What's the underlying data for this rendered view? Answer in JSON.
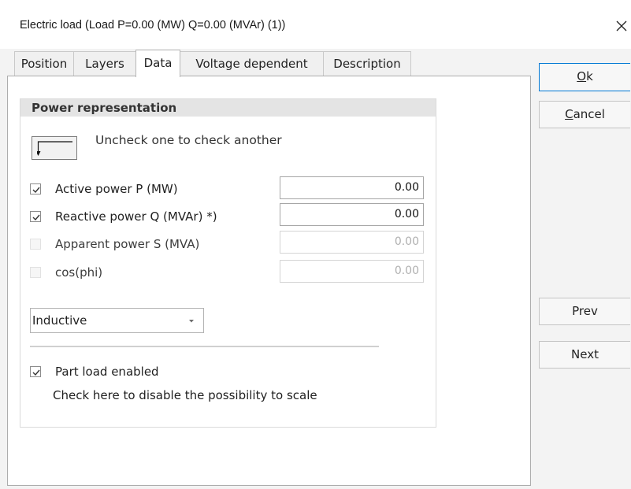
{
  "window": {
    "title": "Electric load   (Load P=0.00 (MW) Q=0.00 (MVAr) (1))"
  },
  "tabs": [
    {
      "label": "Position",
      "active": false
    },
    {
      "label": "Layers",
      "active": false
    },
    {
      "label": "Data",
      "active": true
    },
    {
      "label": "Voltage dependent",
      "active": false
    },
    {
      "label": "Description",
      "active": false
    }
  ],
  "power_group": {
    "title": "Power representation",
    "hint": "Uncheck one to check another",
    "rows": [
      {
        "label": "Active power P (MW)",
        "checked": true,
        "enabled": true,
        "value": "0.00"
      },
      {
        "label": "Reactive power Q (MVAr) *)",
        "checked": true,
        "enabled": true,
        "value": "0.00"
      },
      {
        "label": "Apparent power S (MVA)",
        "checked": false,
        "enabled": false,
        "value": "0.00"
      },
      {
        "label": "cos(phi)",
        "checked": false,
        "enabled": false,
        "value": "0.00"
      }
    ],
    "load_type": {
      "selected": "Inductive"
    },
    "part_load": {
      "label": "Part load enabled",
      "checked": true,
      "description": "Check here to disable the possibility to scale"
    }
  },
  "buttons": {
    "ok": {
      "mnemonic": "O",
      "rest": "k"
    },
    "cancel": {
      "mnemonic": "C",
      "rest": "ancel"
    },
    "prev": "Prev",
    "next": "Next"
  },
  "colors": {
    "accent_border": "#0078d4",
    "group_header": "#e4e4e4"
  }
}
